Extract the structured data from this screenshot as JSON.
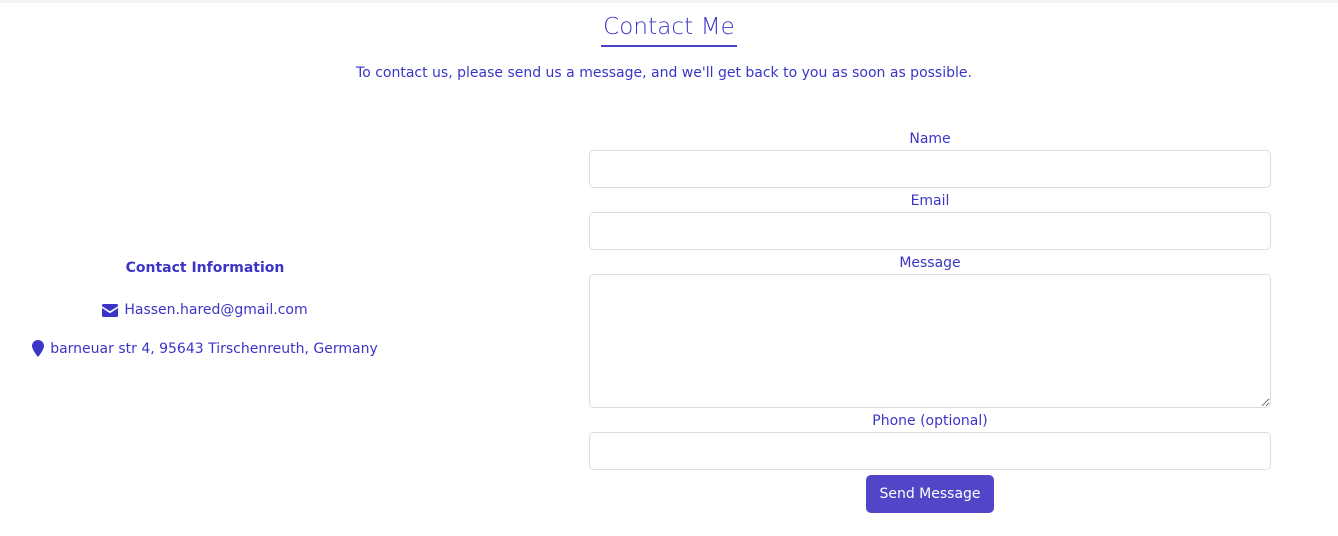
{
  "header": {
    "title": "Contact Me",
    "subtitle": "To contact us, please send us a message, and we'll get back to you as soon as possible."
  },
  "contact_info": {
    "heading": "Contact Information",
    "email": "Hassen.hared@gmail.com",
    "address": "barneuar str 4, 95643 Tirschenreuth, Germany",
    "email_icon": "envelope-icon",
    "address_icon": "map-marker-icon"
  },
  "form": {
    "name_label": "Name",
    "name_value": "",
    "email_label": "Email",
    "email_value": "",
    "message_label": "Message",
    "message_value": "",
    "phone_label": "Phone (optional)",
    "phone_value": "",
    "submit_label": "Send Message"
  },
  "colors": {
    "accent": "#3b35c7",
    "button": "#5046c7"
  }
}
